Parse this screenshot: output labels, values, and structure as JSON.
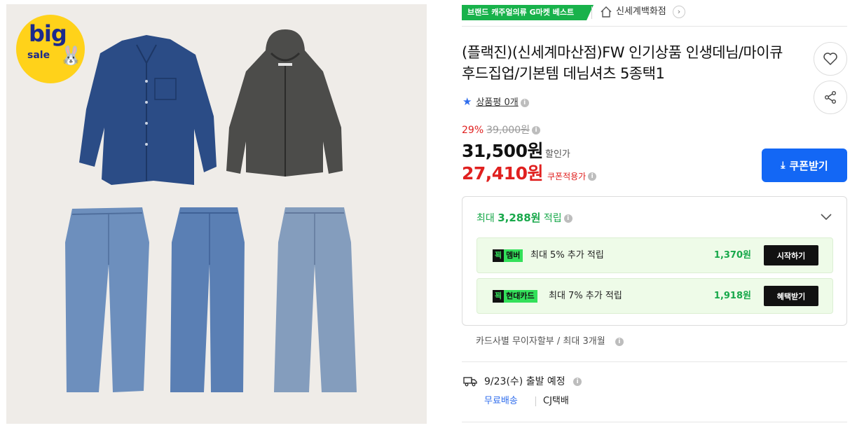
{
  "product_image": {
    "badge_line1": "big",
    "badge_line2": "sale"
  },
  "breadcrumb": {
    "category_tag": "브랜드 캐주얼의류 G마켓 베스트",
    "store_name": "신세계백화점",
    "store_arrow": "›"
  },
  "product": {
    "title": "(플랙진)(신세계마산점)FW 인기상품 인생데님/마이큐 후드집업/기본템 데님셔츠 5종택1"
  },
  "review": {
    "label": "상품평 0개"
  },
  "price": {
    "discount_rate": "29%",
    "original_price": "39,000원",
    "sale_price": "31,500원",
    "sale_label": "할인가",
    "coupon_price": "27,410원",
    "coupon_label": "쿠폰적용가",
    "coupon_button": "쿠폰받기"
  },
  "rewards": {
    "head_prefix": "최대",
    "head_amount": "3,288원",
    "head_suffix": "적립",
    "rows": [
      {
        "tag_mark": "꾁",
        "tag_label": "멤버",
        "desc": "최대 5% 추가 적립",
        "amount": "1,370원",
        "button": "시작하기"
      },
      {
        "tag_mark": "꾁",
        "tag_label": "현대카드",
        "desc": "최대 7% 추가 적립",
        "amount": "1,918원",
        "button": "혜택받기"
      }
    ]
  },
  "installment": {
    "text": "카드사별 무이자할부 / 최대 3개월"
  },
  "shipping": {
    "date_text": "9/23(수) 출발 예정",
    "fee": "무료배송",
    "carrier": "CJ택배"
  },
  "colors": {
    "accent_blue": "#1367f5",
    "price_red": "#e0201f",
    "reward_green": "#18a84a",
    "brand_green": "#18b24b",
    "badge_yellow": "#ffd21a"
  },
  "icons": {
    "home": "home-icon",
    "heart": "heart-icon",
    "share": "share-icon",
    "star": "star-icon",
    "info": "info-icon",
    "download": "download-icon",
    "chevron": "chevron-down-icon",
    "truck": "truck-icon"
  }
}
